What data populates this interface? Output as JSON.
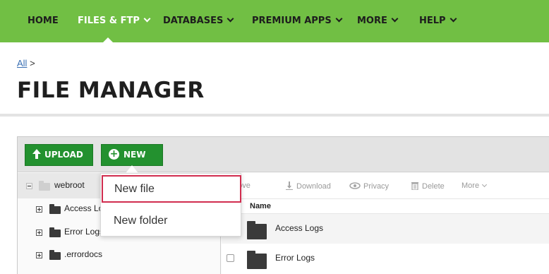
{
  "nav": {
    "items": [
      {
        "label": "HOME",
        "has_dropdown": false,
        "active": false
      },
      {
        "label": "FILES & FTP",
        "has_dropdown": true,
        "active": true
      },
      {
        "label": "DATABASES",
        "has_dropdown": true,
        "active": false
      },
      {
        "label": "PREMIUM APPS",
        "has_dropdown": true,
        "active": false
      },
      {
        "label": "MORE",
        "has_dropdown": true,
        "active": false
      },
      {
        "label": "HELP",
        "has_dropdown": true,
        "active": false
      }
    ]
  },
  "breadcrumb": {
    "link": "All",
    "separator": ">"
  },
  "page": {
    "title": "FILE MANAGER"
  },
  "toolbar": {
    "upload_label": "UPLOAD",
    "new_label": "NEW"
  },
  "tree": {
    "root": "webroot",
    "children": [
      "Access Logs",
      "Error Logs",
      ".errordocs"
    ]
  },
  "file_actions": {
    "move": "Move",
    "download": "Download",
    "privacy": "Privacy",
    "delete": "Delete",
    "more": "More"
  },
  "file_list": {
    "header_name": "Name",
    "rows": [
      "Access Logs",
      "Error Logs"
    ]
  },
  "new_menu": {
    "items": [
      "New file",
      "New folder"
    ]
  },
  "colors": {
    "nav_bg": "#71bf44",
    "button_green": "#23912f",
    "highlight_border": "#d12d4f",
    "link": "#3a6fb3"
  }
}
